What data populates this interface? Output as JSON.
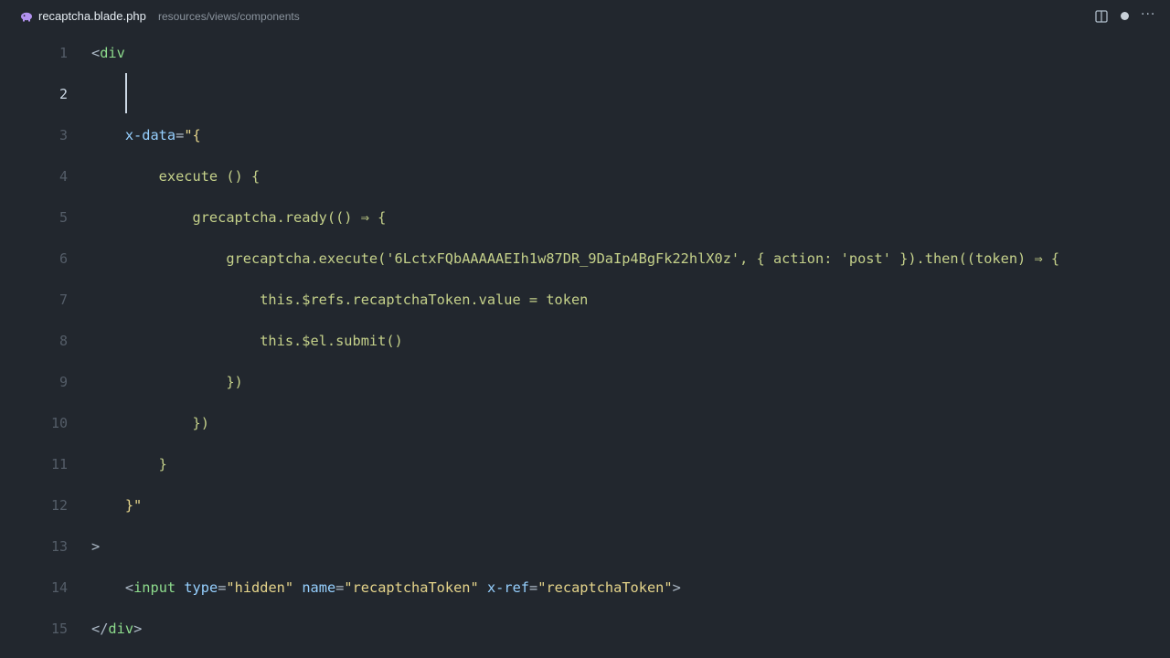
{
  "tab": {
    "file_name": "recaptcha.blade.php",
    "path": "resources/views/components",
    "file_icon": "php-elephant-icon",
    "dot_color": "#c9d1d9"
  },
  "toolbar": {
    "split_icon": "split-editor-icon",
    "more_label": "···"
  },
  "editor": {
    "active_line": 2,
    "lines": [
      {
        "number": "1",
        "code": "<div"
      },
      {
        "number": "2",
        "code": ""
      },
      {
        "number": "3",
        "code": "    x-data=\"{"
      },
      {
        "number": "4",
        "code": "        execute () {"
      },
      {
        "number": "5",
        "code": "            grecaptcha.ready(() ⇒ {"
      },
      {
        "number": "6",
        "code": "                grecaptcha.execute('6LctxFQbAAAAAEIh1w87DR_9DaIp4BgFk22hlX0z', { action: 'post' }).then((token) ⇒ {"
      },
      {
        "number": "7",
        "code": "                    this.$refs.recaptchaToken.value = token"
      },
      {
        "number": "8",
        "code": "                    this.$el.submit()"
      },
      {
        "number": "9",
        "code": "                })"
      },
      {
        "number": "10",
        "code": "            })"
      },
      {
        "number": "11",
        "code": "        }"
      },
      {
        "number": "12",
        "code": "    }\""
      },
      {
        "number": "13",
        "code": ">"
      },
      {
        "number": "14",
        "code": "    <input type=\"hidden\" name=\"recaptchaToken\" x-ref=\"recaptchaToken\">"
      },
      {
        "number": "15",
        "code": "</div>"
      }
    ]
  }
}
